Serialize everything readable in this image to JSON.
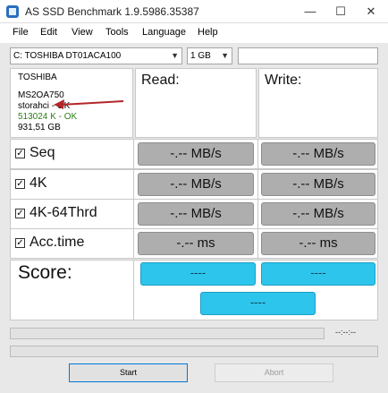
{
  "window": {
    "title": "AS SSD Benchmark 1.9.5986.35387",
    "minimize": "—",
    "maximize": "☐",
    "close": "✕"
  },
  "menu": [
    "File",
    "Edit",
    "View",
    "Tools",
    "Language",
    "Help"
  ],
  "toolbar": {
    "drive": "C: TOSHIBA DT01ACA100",
    "size": "1 GB"
  },
  "drive_info": {
    "model": "TOSHIBA",
    "firmware": "MS2OA750",
    "driver": "storahci - OK",
    "alignment": "513024 K - OK",
    "capacity": "931,51 GB"
  },
  "columns": {
    "read": "Read:",
    "write": "Write:"
  },
  "tests": [
    {
      "label": "Seq",
      "checked": "☑",
      "read": "-.-- MB/s",
      "write": "-.-- MB/s"
    },
    {
      "label": "4K",
      "checked": "☑",
      "read": "-.-- MB/s",
      "write": "-.-- MB/s"
    },
    {
      "label": "4K-64Thrd",
      "checked": "☑",
      "read": "-.-- MB/s",
      "write": "-.-- MB/s"
    },
    {
      "label": "Acc.time",
      "checked": "☑",
      "read": "-.-- ms",
      "write": "-.-- ms"
    }
  ],
  "score": {
    "label": "Score:",
    "read": "----",
    "write": "----",
    "total": "----"
  },
  "status": {
    "elapsed": "--:--:--"
  },
  "buttons": {
    "start": "Start",
    "abort": "Abort"
  },
  "colors": {
    "score_box": "#2ec5ec",
    "result_box": "#aeaeae",
    "annotation": "#b3272a"
  }
}
